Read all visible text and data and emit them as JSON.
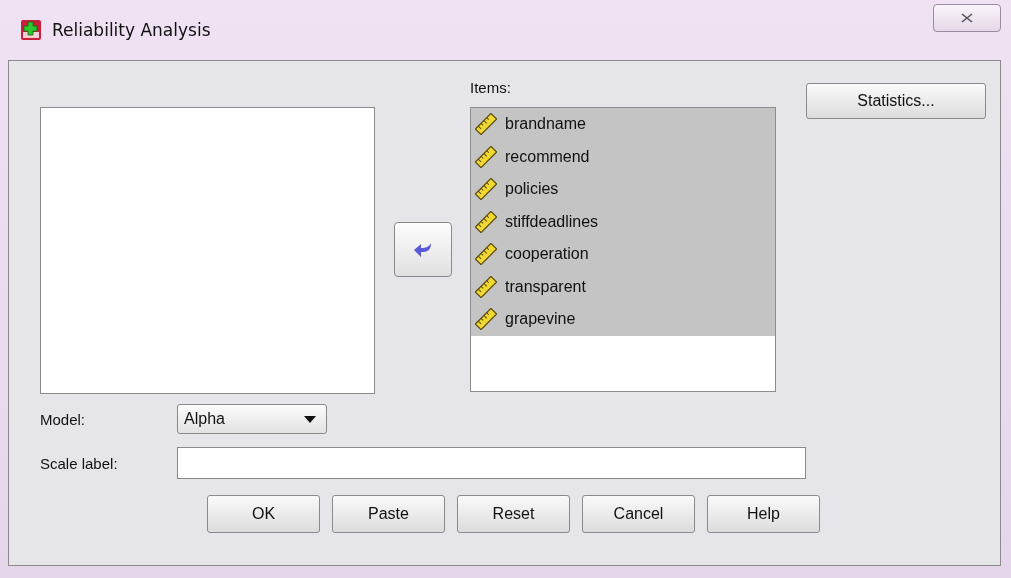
{
  "window": {
    "title": "Reliability Analysis"
  },
  "items_list": {
    "label": "Items:",
    "items": [
      {
        "name": "brandname",
        "selected": true
      },
      {
        "name": "recommend",
        "selected": true
      },
      {
        "name": "policies",
        "selected": true
      },
      {
        "name": "stiffdeadlines",
        "selected": true
      },
      {
        "name": "cooperation",
        "selected": true
      },
      {
        "name": "transparent",
        "selected": true
      },
      {
        "name": "grapevine",
        "selected": true
      }
    ]
  },
  "statistics_button": "Statistics...",
  "model": {
    "label": "Model:",
    "value": "Alpha"
  },
  "scale_label": {
    "label": "Scale label:"
  },
  "buttons": [
    "OK",
    "Paste",
    "Reset",
    "Cancel",
    "Help"
  ]
}
